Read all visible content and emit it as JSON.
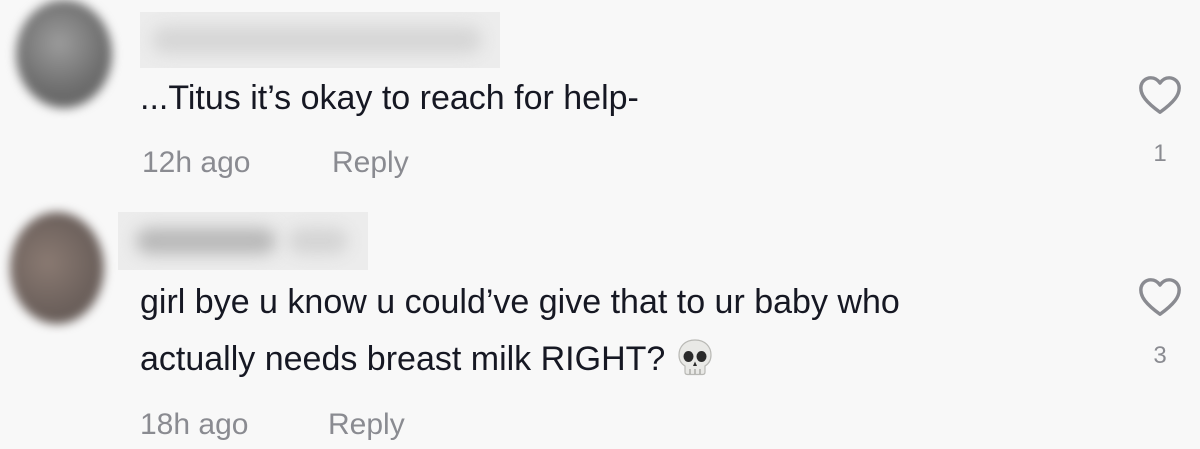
{
  "comments": [
    {
      "text": "...Titus it’s okay to reach for help-",
      "time": "12h ago",
      "reply_label": "Reply",
      "likes": "1"
    },
    {
      "text_line1": "girl bye u know u could’ve give that to ur baby who",
      "text_line2": "actually needs breast milk RIGHT?",
      "emoji_icon": "skull-icon",
      "time": "18h ago",
      "reply_label": "Reply",
      "likes": "3"
    }
  ],
  "colors": {
    "background": "#f8f8f8",
    "text": "#161823",
    "secondary_text": "#8a8b91"
  }
}
